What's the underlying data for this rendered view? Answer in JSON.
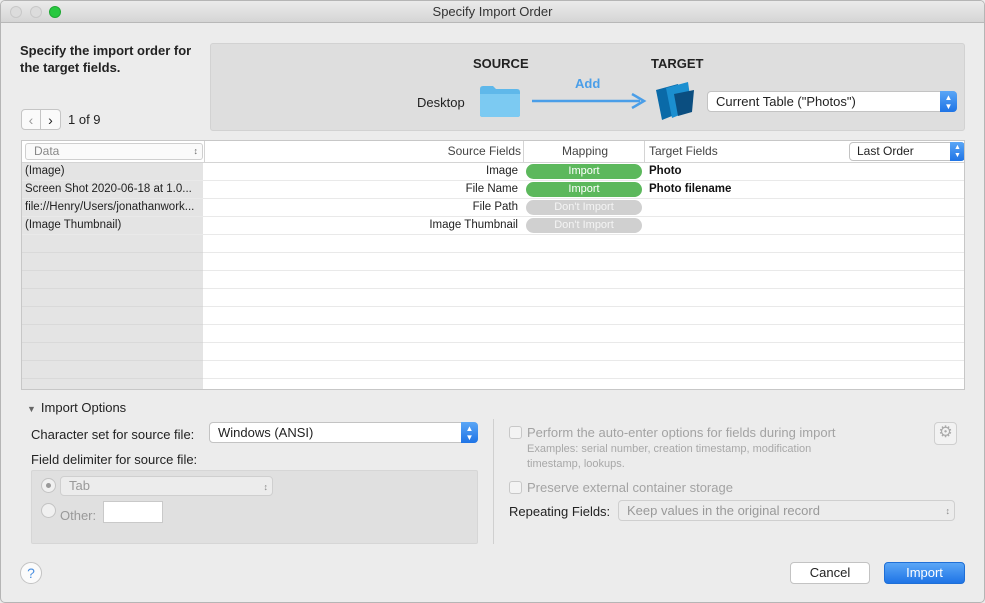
{
  "window": {
    "title": "Specify Import Order"
  },
  "prompt": "Specify the import order for the target fields.",
  "nav": {
    "record_label": "1 of 9",
    "prev_icon": "chevron-left-icon",
    "next_icon": "chevron-right-icon"
  },
  "flow": {
    "source_label": "SOURCE",
    "target_label": "TARGET",
    "source_name": "Desktop",
    "action_label": "Add",
    "target_table": "Current Table (\"Photos\")",
    "accent": "#4a9ee8"
  },
  "grid": {
    "data_select": "Data",
    "headers": {
      "source": "Source Fields",
      "mapping": "Mapping",
      "target": "Target Fields"
    },
    "order_select": "Last Order",
    "rows": [
      {
        "data": "(Image)",
        "source": "Image",
        "mapping": "Import",
        "target": "Photo"
      },
      {
        "data": "Screen Shot 2020-06-18 at 1.0...",
        "source": "File Name",
        "mapping": "Import",
        "target": "Photo filename"
      },
      {
        "data": "file://Henry/Users/jonathanwork...",
        "source": "File Path",
        "mapping": "Don't Import",
        "target": ""
      },
      {
        "data": "(Image Thumbnail)",
        "source": "Image Thumbnail",
        "mapping": "Don't Import",
        "target": ""
      }
    ],
    "colors": {
      "import": "#5cb85c",
      "dont_import": "#d0d0d0"
    }
  },
  "options": {
    "toggle_label": "Import Options",
    "charset_label": "Character set for source file:",
    "charset_value": "Windows (ANSI)",
    "delimiter_label": "Field delimiter for source file:",
    "delimiter_value": "Tab",
    "other_label": "Other:",
    "autoenter_label": "Perform the auto-enter options for fields during import",
    "autoenter_examples": "Examples: serial number, creation timestamp, modification timestamp, lookups.",
    "preserve_label": "Preserve external container storage",
    "repeating_label": "Repeating Fields:",
    "repeating_value": "Keep values in the original record"
  },
  "footer": {
    "help": "?",
    "cancel": "Cancel",
    "import": "Import"
  }
}
